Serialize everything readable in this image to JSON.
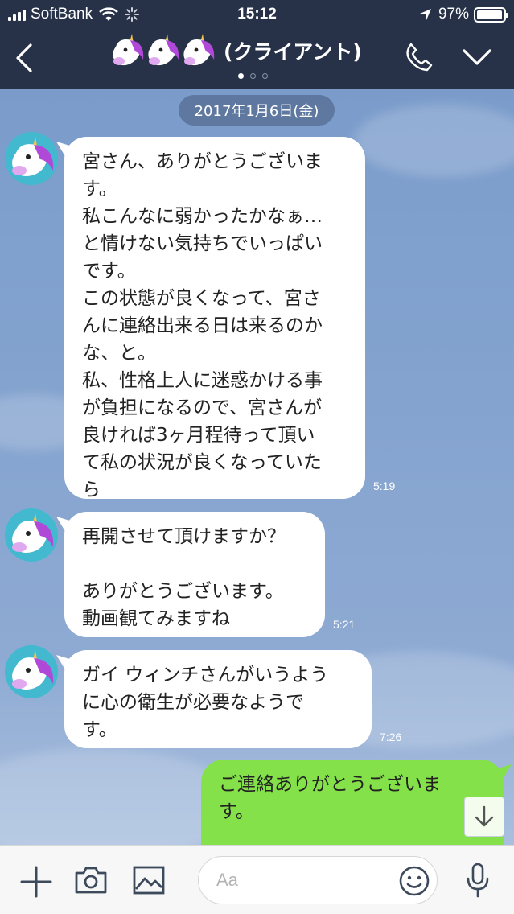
{
  "status_bar": {
    "carrier": "SoftBank",
    "time": "15:12",
    "battery_percent": "97%",
    "battery_level": 0.97
  },
  "header": {
    "title": "(クライアント)",
    "page_dots": 3,
    "active_dot": 0
  },
  "chat": {
    "date": "2017年1月6日(金)",
    "messages": [
      {
        "side": "left",
        "text": "宮さん、ありがとうございま\nす。\n私こんなに弱かったかなぁ…\nと情けない気持ちでいっぱい\nです。\nこの状態が良くなって、宮さ\nんに連絡出来る日は来るのか\nな、と。\n私、性格上人に迷惑かける事\nが負担になるので、宮さんが\n良ければ3ヶ月程待って頂い\nて私の状況が良くなっていた\nら",
        "time": "5:19"
      },
      {
        "side": "left",
        "text": "再開させて頂けますか？\n\nありがとうございます。\n動画観てみますね",
        "time": "5:21"
      },
      {
        "side": "left",
        "text": "ガイ ウィンチさんがいうよう\nに心の衛生が必要なようで\nす。",
        "time": "7:26"
      },
      {
        "side": "right",
        "text": "ご連絡ありがとうございま\nす。"
      }
    ]
  },
  "input": {
    "placeholder": "Aa"
  },
  "colors": {
    "header_bg": "#273248",
    "my_bubble": "#85e14a",
    "their_bubble": "#ffffff",
    "avatar_bg": "#42b9ce"
  },
  "icons": {
    "back": "chevron-left-icon",
    "call": "phone-icon",
    "menu": "chevron-down-icon",
    "add": "plus-icon",
    "camera": "camera-icon",
    "image": "image-icon",
    "emoji": "emoji-icon",
    "mic": "microphone-icon",
    "scroll": "arrow-down-icon"
  }
}
